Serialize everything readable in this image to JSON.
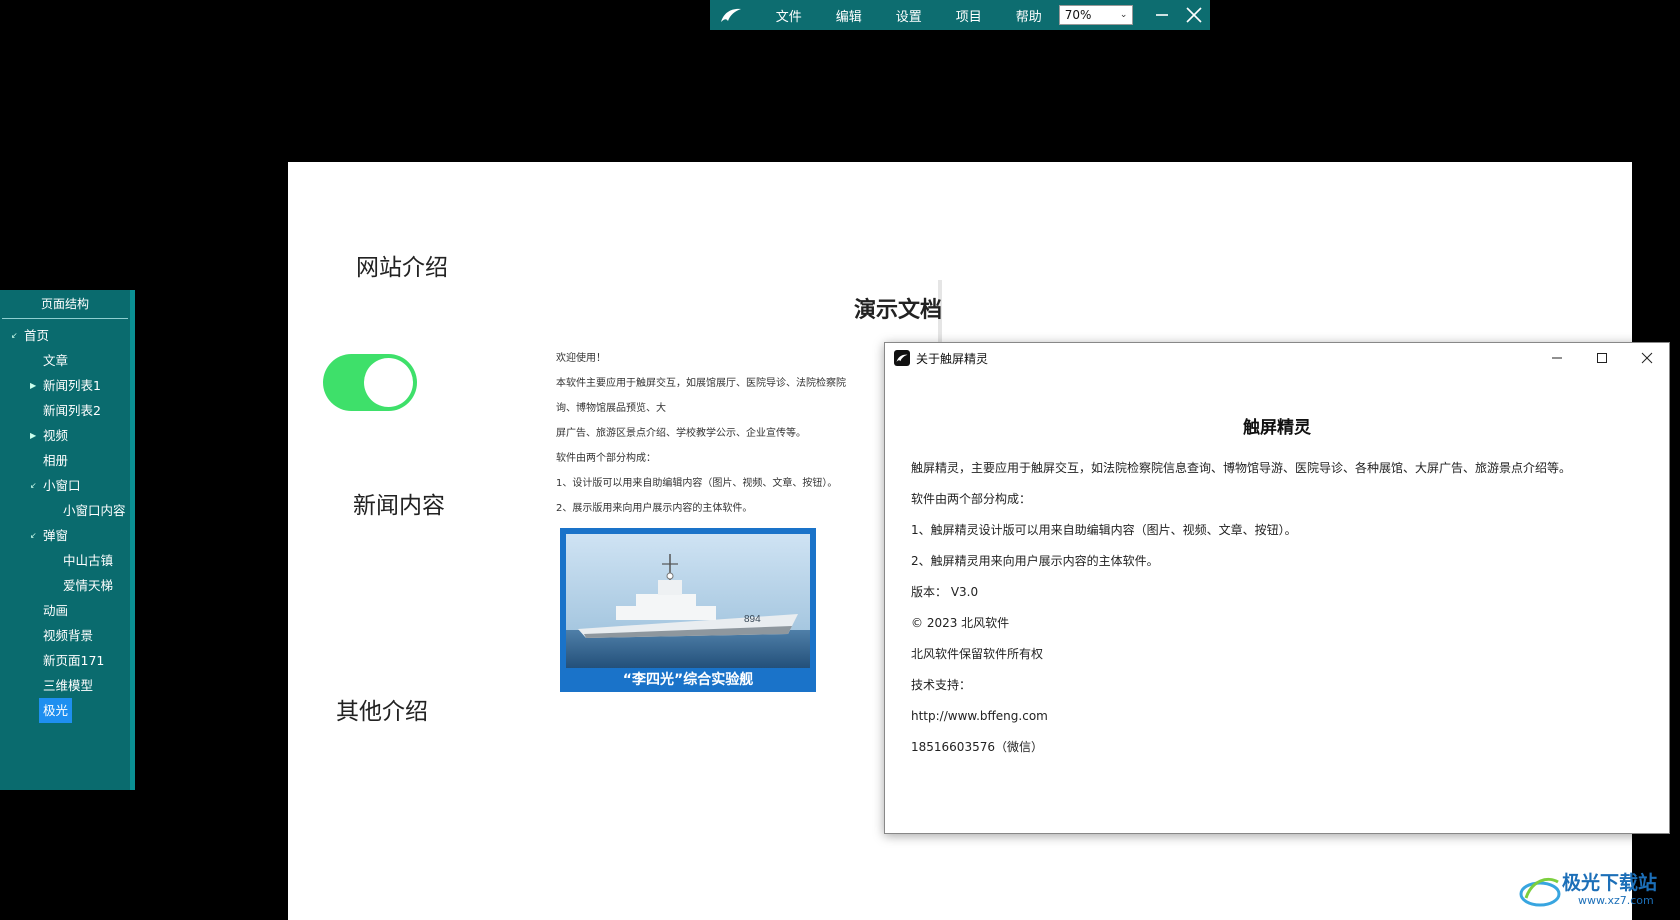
{
  "toolbar": {
    "menu": [
      "文件",
      "编辑",
      "设置",
      "项目",
      "帮助"
    ],
    "zoom": "70%"
  },
  "sidebar": {
    "title": "页面结构",
    "items": [
      {
        "label": "首页",
        "level": 0,
        "arrow": "down"
      },
      {
        "label": "文章",
        "level": 1,
        "arrow": ""
      },
      {
        "label": "新闻列表1",
        "level": 1,
        "arrow": "right"
      },
      {
        "label": "新闻列表2",
        "level": 1,
        "arrow": ""
      },
      {
        "label": "视频",
        "level": 1,
        "arrow": "right"
      },
      {
        "label": "相册",
        "level": 1,
        "arrow": ""
      },
      {
        "label": "小窗口",
        "level": 1,
        "arrow": "down"
      },
      {
        "label": "小窗口内容",
        "level": 2,
        "arrow": ""
      },
      {
        "label": "弹窗",
        "level": 1,
        "arrow": "down"
      },
      {
        "label": "中山古镇",
        "level": 2,
        "arrow": ""
      },
      {
        "label": "爱情天梯",
        "level": 2,
        "arrow": ""
      },
      {
        "label": "动画",
        "level": 1,
        "arrow": ""
      },
      {
        "label": "视频背景",
        "level": 1,
        "arrow": ""
      },
      {
        "label": "新页面171",
        "level": 1,
        "arrow": ""
      },
      {
        "label": "三维模型",
        "level": 1,
        "arrow": ""
      },
      {
        "label": "极光",
        "level": 1,
        "arrow": "",
        "selected": true
      }
    ]
  },
  "canvas": {
    "headings": [
      "网站介绍",
      "新闻内容",
      "其他介绍"
    ],
    "toggle_on": true,
    "doc_title": "演示文档",
    "doc_lines": [
      "欢迎使用！",
      "本软件主要应用于触屏交互，如展馆展厅、医院导诊、法院检察院",
      "询、博物馆展品预览、大",
      "屏广告、旅游区景点介绍、学校教学公示、企业宣传等。",
      "软件由两个部分构成：",
      "1、设计版可以用来自助编辑内容（图片、视频、文章、按钮）。",
      "2、展示版用来向用户展示内容的主体软件。"
    ],
    "image_caption": "“李四光”综合实验舰",
    "ship_number": "894"
  },
  "about": {
    "window_title": "关于触屏精灵",
    "heading": "触屏精灵",
    "lines": [
      "触屏精灵，主要应用于触屏交互，如法院检察院信息查询、博物馆导游、医院导诊、各种展馆、大屏广告、旅游景点介绍等。",
      "软件由两个部分构成：",
      "1、触屏精灵设计版可以用来自助编辑内容（图片、视频、文章、按钮）。",
      "2、触屏精灵用来向用户展示内容的主体软件。",
      "版本： V3.0",
      "© 2023 北风软件",
      "北风软件保留软件所有权",
      "技术支持：",
      "http://www.bffeng.com",
      "18516603576（微信）"
    ]
  },
  "watermark": {
    "name": "极光下载站",
    "url": "www.xz7.com"
  }
}
